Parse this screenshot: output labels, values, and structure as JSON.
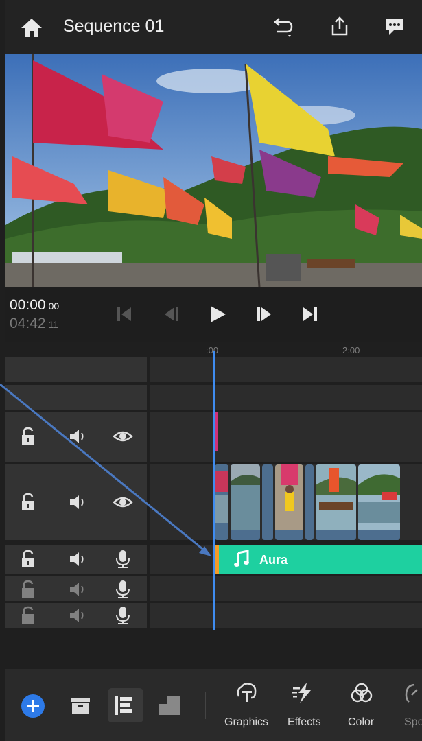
{
  "header": {
    "title": "Sequence 01",
    "icons": [
      "home-icon",
      "undo-icon",
      "share-icon",
      "comment-icon"
    ]
  },
  "transport": {
    "current_time": "00:00",
    "current_frames": "00",
    "total_time": "04:42",
    "total_frames": "11",
    "buttons": [
      "go-to-start-icon",
      "step-back-icon",
      "play-icon",
      "step-forward-icon",
      "go-to-end-icon"
    ]
  },
  "ruler": {
    "labels": [
      ":00",
      "2:00"
    ]
  },
  "audio_clip": {
    "name": "Aura"
  },
  "colors": {
    "accent": "#3f8cf0",
    "audio_clip": "#1ed0a0",
    "audio_clip_edge": "#f29c29",
    "add_button": "#2d7ae8"
  },
  "toolbar": {
    "left_buttons": [
      "add-button",
      "archive-icon",
      "timeline-view-icon",
      "layers-icon"
    ],
    "tools": [
      {
        "label": "Graphics",
        "icon": "graphics-icon"
      },
      {
        "label": "Effects",
        "icon": "effects-icon"
      },
      {
        "label": "Color",
        "icon": "color-icon"
      },
      {
        "label": "Spe",
        "icon": "speed-icon"
      }
    ]
  }
}
